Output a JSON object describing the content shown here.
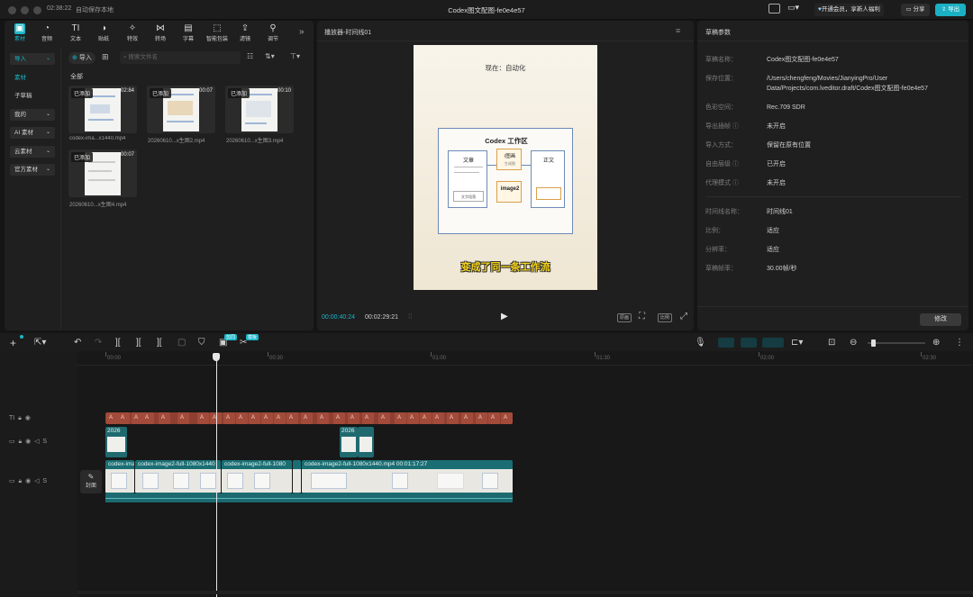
{
  "app": {
    "time": "02:38:22",
    "autosave": "自动保存本地",
    "title": "Codex图文配图-fe0e4e57",
    "vip": "开通会员，享新人福利",
    "share": "分享",
    "export": "导出"
  },
  "toolbar": [
    {
      "label": "素材",
      "icon": "media-icon",
      "glyph": "▣"
    },
    {
      "label": "音频",
      "icon": "audio-icon",
      "glyph": "◔"
    },
    {
      "label": "文本",
      "icon": "text-icon",
      "glyph": "TI"
    },
    {
      "label": "贴纸",
      "icon": "sticker-icon",
      "glyph": "◑"
    },
    {
      "label": "特效",
      "icon": "effects-icon",
      "glyph": "✧"
    },
    {
      "label": "转场",
      "icon": "transition-icon",
      "glyph": "⋈"
    },
    {
      "label": "字幕",
      "icon": "subtitle-icon",
      "glyph": "▤"
    },
    {
      "label": "智能包装",
      "icon": "smart-pack-icon",
      "glyph": "⬚"
    },
    {
      "label": "滤镜",
      "icon": "filter-icon",
      "glyph": "⇪"
    },
    {
      "label": "调节",
      "icon": "adjust-icon",
      "glyph": "⚲"
    }
  ],
  "sidebar": [
    {
      "label": "导入",
      "dropdown": true,
      "active": true
    },
    {
      "label": "素材",
      "dropdown": false,
      "active": true
    },
    {
      "label": "子草稿",
      "dropdown": false
    },
    {
      "label": "我的",
      "dropdown": true
    },
    {
      "label": "AI 素材",
      "dropdown": true
    },
    {
      "label": "云素材",
      "dropdown": true
    },
    {
      "label": "官方素材",
      "dropdown": true
    }
  ],
  "media": {
    "import_label": "导入",
    "search_placeholder": "搜索文件名",
    "section": "全部",
    "items": [
      {
        "tag": "已添加",
        "duration": "02:84",
        "name": "codex-ima...x1440.mp4"
      },
      {
        "tag": "已添加",
        "duration": "00:07",
        "name": "20260610...x生图2.mp4"
      },
      {
        "tag": "已添加",
        "duration": "00:10",
        "name": "20260610...x生图3.mp4"
      },
      {
        "tag": "已添加",
        "duration": "00:07",
        "name": "20260610...x生图4.mp4"
      }
    ]
  },
  "player": {
    "title": "播放器-时间线01",
    "current_time": "00:00:40:24",
    "total_time": "00:02:29:21",
    "preview_heading": "现在：自动化",
    "diagram_title": "Codex 工作区",
    "boxes": [
      "文章",
      "/图画",
      "image2",
      "正文"
    ],
    "sub_labels": [
      "生成图",
      "文字段落"
    ],
    "subtitle": "变成了同一条工作流",
    "buttons": [
      "原画",
      "比例"
    ]
  },
  "props": {
    "title": "草稿参数",
    "rows": [
      {
        "k": "草稿名称：",
        "v": "Codex图文配图-fe0e4e57"
      },
      {
        "k": "保存位置：",
        "v": "/Users/chengfeng/Movies/JianyingPro/User Data/Projects/com.lveditor.draft/Codex图文配图-fe0e4e57"
      },
      {
        "k": "色彩空间：",
        "v": "Rec.709 SDR"
      },
      {
        "k": "导出插帧 ⓘ",
        "v": "未开启"
      },
      {
        "k": "导入方式：",
        "v": "保留在原有位置"
      },
      {
        "k": "自由层级 ⓘ",
        "v": "已开启"
      },
      {
        "k": "代理模式 ⓘ",
        "v": "未开启"
      },
      {
        "k": "时间线名称：",
        "v": "时间线01"
      },
      {
        "k": "比例：",
        "v": "适应"
      },
      {
        "k": "分辨率：",
        "v": "适应"
      },
      {
        "k": "草稿帧率：",
        "v": "30.00帧/秒"
      }
    ],
    "modify": "修改"
  },
  "timeline": {
    "ruler": [
      "00:00",
      "00:30",
      "01:00",
      "01:30",
      "02:00",
      "02:30"
    ],
    "cover": "封面",
    "small_clip": "2026",
    "clips": [
      {
        "label": "codex-ima"
      },
      {
        "label": "codex-image2-full-1080x1440"
      },
      {
        "label": "codex-image2-full-1080"
      },
      {
        "label": "codex-image2-full-1080x1440.mp4  00:01:17:27"
      }
    ],
    "badges": [
      "剪同",
      "模板"
    ]
  }
}
